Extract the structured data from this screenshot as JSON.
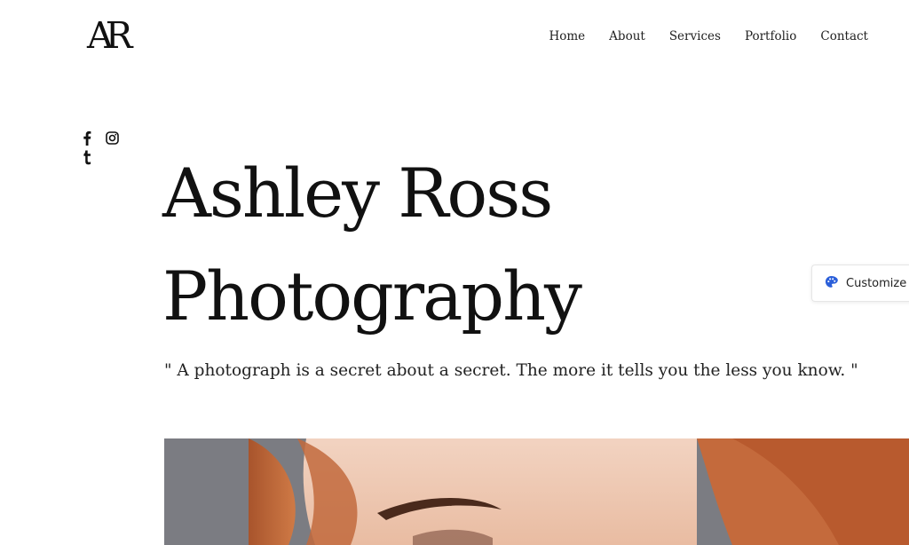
{
  "brand": {
    "logo_text": "AR"
  },
  "nav": {
    "items": [
      "Home",
      "About",
      "Services",
      "Portfolio",
      "Contact"
    ]
  },
  "social": {
    "icons": [
      "facebook-icon",
      "instagram-icon",
      "tumblr-icon"
    ]
  },
  "hero": {
    "title_line1": "Ashley Ross",
    "title_line2": "Photography",
    "quote": "\" A photograph is a secret about a secret. The more it tells you the less you know. \""
  },
  "customize": {
    "label": "Customize",
    "icon": "palette-icon",
    "icon_color": "#2b5fd9"
  },
  "colors": {
    "text": "#111111",
    "background": "#ffffff",
    "hair": "#c0693c",
    "skin": "#efc9b3"
  }
}
